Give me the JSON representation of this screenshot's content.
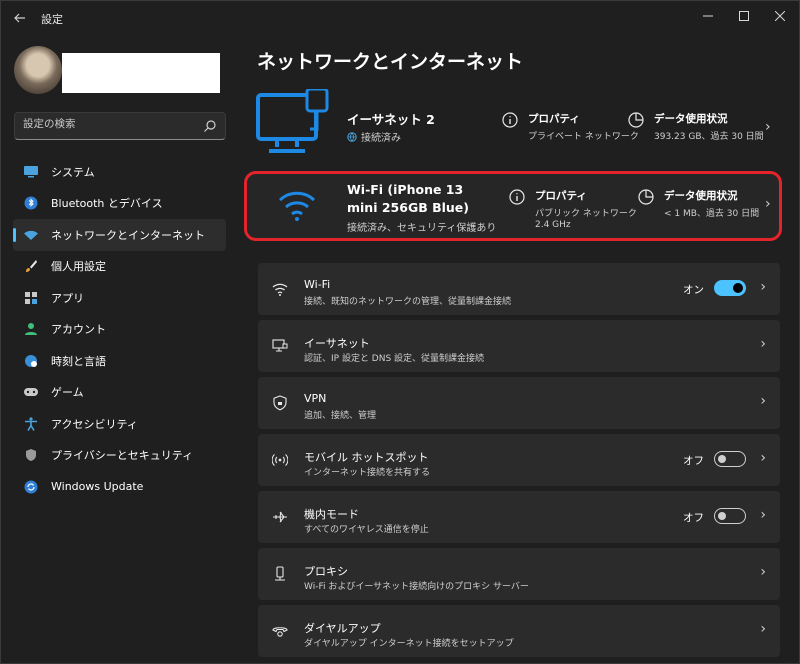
{
  "window": {
    "title": "設定"
  },
  "sidebar": {
    "search_placeholder": "設定の検索",
    "items": [
      {
        "label": "システム",
        "icon": "monitor-icon"
      },
      {
        "label": "Bluetooth とデバイス",
        "icon": "bluetooth-icon"
      },
      {
        "label": "ネットワークとインターネット",
        "icon": "network-icon",
        "active": true
      },
      {
        "label": "個人用設定",
        "icon": "brush-icon"
      },
      {
        "label": "アプリ",
        "icon": "apps-icon"
      },
      {
        "label": "アカウント",
        "icon": "account-icon"
      },
      {
        "label": "時刻と言語",
        "icon": "globe-clock-icon"
      },
      {
        "label": "ゲーム",
        "icon": "gamepad-icon"
      },
      {
        "label": "アクセシビリティ",
        "icon": "accessibility-icon"
      },
      {
        "label": "プライバシーとセキュリティ",
        "icon": "shield-icon"
      },
      {
        "label": "Windows Update",
        "icon": "update-icon"
      }
    ]
  },
  "main": {
    "title": "ネットワークとインターネット",
    "ethernet": {
      "name": "イーサネット 2",
      "status": "接続済み",
      "properties_title": "プロパティ",
      "properties_sub": "プライベート ネットワーク",
      "usage_title": "データ使用状況",
      "usage_sub": "393.23 GB、過去 30 日間"
    },
    "wifi": {
      "name": "Wi-Fi (iPhone 13 mini 256GB Blue)",
      "status": "接続済み、セキュリティ保護あり",
      "properties_title": "プロパティ",
      "properties_sub1": "パブリック ネットワーク",
      "properties_sub2": "2.4 GHz",
      "usage_title": "データ使用状況",
      "usage_sub": "< 1 MB、過去 30 日間"
    },
    "rows": [
      {
        "title": "Wi-Fi",
        "sub": "接続、既知のネットワークの管理、従量制課金接続",
        "icon": "wifi-icon",
        "toggle": "オン"
      },
      {
        "title": "イーサネット",
        "sub": "認証、IP 設定と DNS 設定、従量制課金接続",
        "icon": "ethernet-icon"
      },
      {
        "title": "VPN",
        "sub": "追加、接続、管理",
        "icon": "vpn-shield-icon"
      },
      {
        "title": "モバイル ホットスポット",
        "sub": "インターネット接続を共有する",
        "icon": "hotspot-icon",
        "toggle": "オフ"
      },
      {
        "title": "機内モード",
        "sub": "すべてのワイヤレス通信を停止",
        "icon": "airplane-icon",
        "toggle": "オフ"
      },
      {
        "title": "プロキシ",
        "sub": "Wi-Fi およびイーサネット接続向けのプロキシ サーバー",
        "icon": "proxy-icon"
      },
      {
        "title": "ダイヤルアップ",
        "sub": "ダイヤルアップ インターネット接続をセットアップ",
        "icon": "dialup-icon"
      }
    ]
  },
  "colors": {
    "accent": "#4cc2ff",
    "highlight": "#e3242b",
    "background": "#1f1f1f",
    "card": "#2b2b2b"
  }
}
